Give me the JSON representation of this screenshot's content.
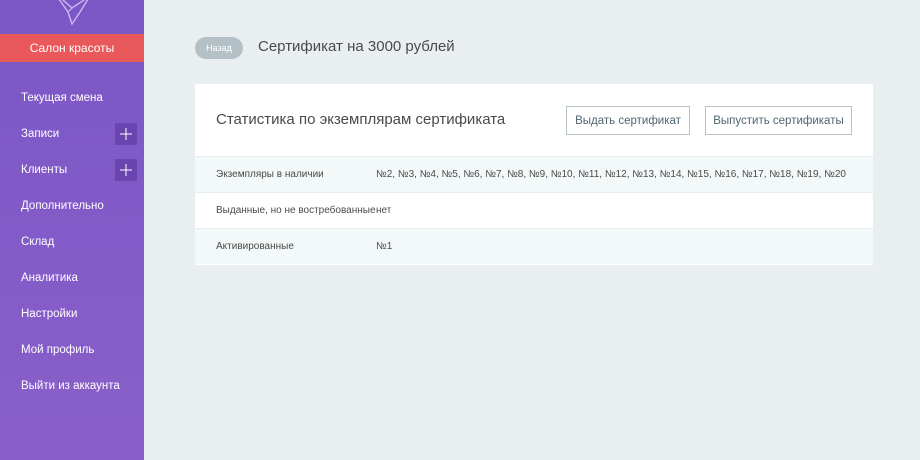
{
  "sidebar": {
    "salon_button": "Салон красоты",
    "items": [
      {
        "label": "Текущая смена",
        "has_plus": false
      },
      {
        "label": "Записи",
        "has_plus": true
      },
      {
        "label": "Клиенты",
        "has_plus": true
      },
      {
        "label": "Дополнительно",
        "has_plus": false
      },
      {
        "label": "Склад",
        "has_plus": false
      },
      {
        "label": "Аналитика",
        "has_plus": false
      },
      {
        "label": "Настройки",
        "has_plus": false
      },
      {
        "label": "Мой профиль",
        "has_plus": false
      },
      {
        "label": "Выйти из аккаунта",
        "has_plus": false
      }
    ],
    "icons": {
      "logo": "bird-logo-icon",
      "plus": "plus-icon"
    }
  },
  "header": {
    "back_label": "Назад",
    "title": "Сертификат на 3000 рублей"
  },
  "card": {
    "title": "Статистика по экземплярам сертификата",
    "issue_button": "Выдать сертификат",
    "release_button": "Выпустить сертификаты",
    "rows": [
      {
        "label": "Экземпляры в наличии",
        "value": "№2, №3, №4, №5, №6, №7, №8, №9, №10, №11, №12, №13, №14, №15, №16, №17, №18, №19, №20"
      },
      {
        "label": "Выданные, но не востребованные",
        "value": "нет"
      },
      {
        "label": "Активированные",
        "value": "№1"
      }
    ]
  },
  "colors": {
    "sidebar": "#7b57c6",
    "accent_red": "#e9585a",
    "background": "#e9eff1"
  }
}
